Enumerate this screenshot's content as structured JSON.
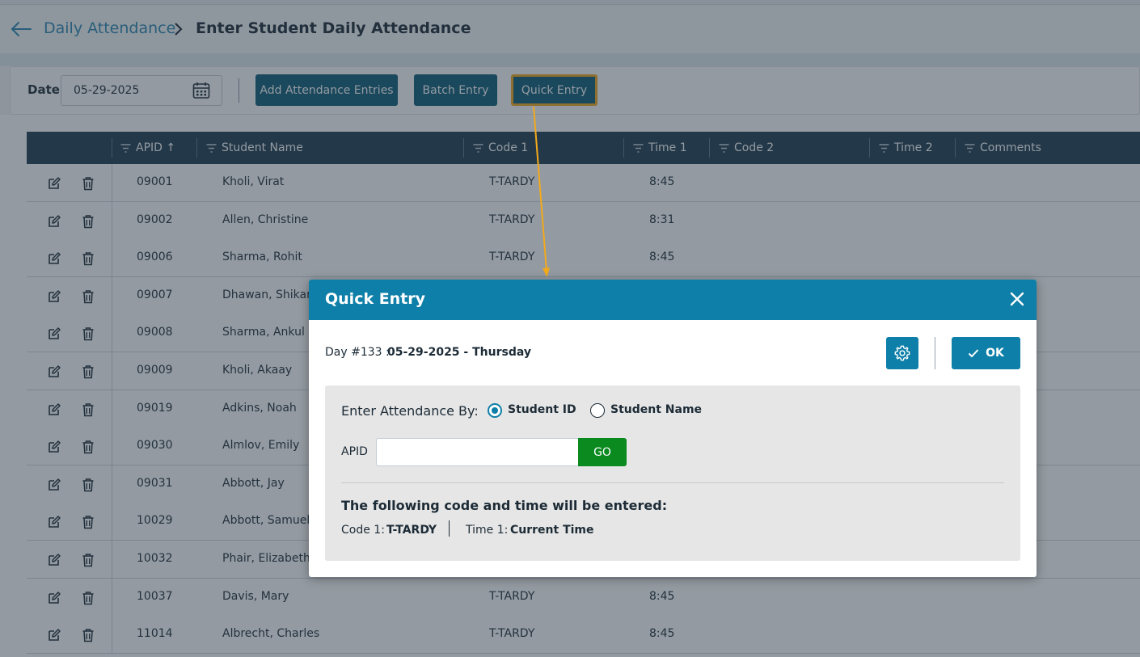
{
  "header": {
    "breadcrumb_link": "Daily Attendance",
    "title": "Enter Student Daily Attendance"
  },
  "toolbar": {
    "date_label": "Date",
    "date_value": "05-29-2025",
    "add_label": "Add Attendance Entries",
    "batch_label": "Batch Entry",
    "quick_label": "Quick Entry"
  },
  "table": {
    "columns": [
      "APID ↑",
      "Student Name",
      "Code 1",
      "Time 1",
      "Code 2",
      "Time 2",
      "Comments"
    ],
    "rows": [
      {
        "apid": "09001",
        "name": "Kholi, Virat",
        "code1": "T-TARDY",
        "time1": "8:45"
      },
      {
        "apid": "09002",
        "name": "Allen, Christine",
        "code1": "T-TARDY",
        "time1": "8:31"
      },
      {
        "apid": "09006",
        "name": "Sharma, Rohit",
        "code1": "T-TARDY",
        "time1": "8:45"
      },
      {
        "apid": "09007",
        "name": "Dhawan, Shikar",
        "code1": "",
        "time1": ""
      },
      {
        "apid": "09008",
        "name": "Sharma, Ankul",
        "code1": "",
        "time1": ""
      },
      {
        "apid": "09009",
        "name": "Kholi, Akaay",
        "code1": "",
        "time1": ""
      },
      {
        "apid": "09019",
        "name": "Adkins, Noah",
        "code1": "",
        "time1": ""
      },
      {
        "apid": "09030",
        "name": "Almlov, Emily",
        "code1": "",
        "time1": ""
      },
      {
        "apid": "09031",
        "name": "Abbott, Jay",
        "code1": "",
        "time1": ""
      },
      {
        "apid": "10029",
        "name": "Abbott, Samuel",
        "code1": "",
        "time1": ""
      },
      {
        "apid": "10032",
        "name": "Phair, Elizabeth",
        "code1": "",
        "time1": ""
      },
      {
        "apid": "10037",
        "name": "Davis, Mary",
        "code1": "T-TARDY",
        "time1": "8:45"
      },
      {
        "apid": "11014",
        "name": "Albrecht, Charles",
        "code1": "T-TARDY",
        "time1": "8:45"
      }
    ]
  },
  "modal": {
    "title": "Quick Entry",
    "day_label": "Day #133 :",
    "day_value": "05-29-2025 - Thursday",
    "ok_label": "OK",
    "enter_by_label": "Enter Attendance By:",
    "option_student_id": "Student ID",
    "option_student_name": "Student Name",
    "selected_option": "Student ID",
    "apid_label": "APID",
    "apid_value": "",
    "go_label": "GO",
    "following_text": "The following code and time will be entered:",
    "code1_label": "Code 1:",
    "code1_value": "T-TARDY",
    "time1_label": "Time 1:",
    "time1_value": "Current Time"
  },
  "colors": {
    "primary_button": "#0c5a74",
    "modal_header": "#0e7fa8",
    "go_button": "#0a8a1f",
    "highlight": "#f2a91d",
    "table_header": "#1f3a4d"
  }
}
